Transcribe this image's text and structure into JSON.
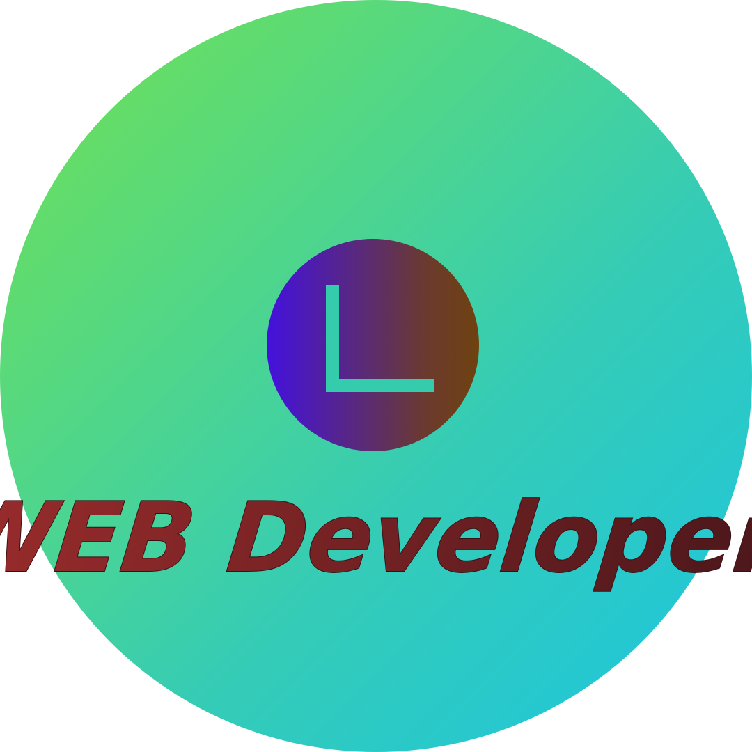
{
  "logo": {
    "letter": "L",
    "letter_color": "#35ccae",
    "circle_gradient": [
      "#4411dd",
      "#6f4210"
    ]
  },
  "headline": {
    "text": "WEB Developer",
    "gradient": [
      "#9a2c2c",
      "#4a171b"
    ]
  },
  "background": {
    "gradient": [
      "#72e04f",
      "#1bc5e2"
    ]
  }
}
